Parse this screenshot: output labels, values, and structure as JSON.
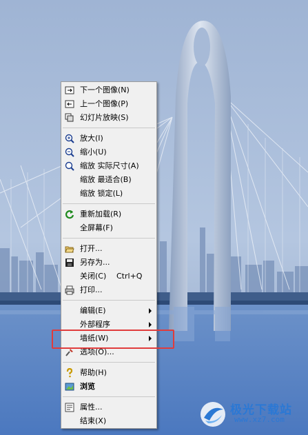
{
  "menu": {
    "items": [
      {
        "label": "下一个图像(N)",
        "icon": "next-image-icon"
      },
      {
        "label": "上一个图像(P)",
        "icon": "prev-image-icon"
      },
      {
        "label": "幻灯片放映(S)",
        "icon": "slideshow-icon"
      },
      {
        "label": "放大(I)",
        "icon": "zoom-in-icon"
      },
      {
        "label": "缩小(U)",
        "icon": "zoom-out-icon"
      },
      {
        "label": "缩放 实际尺寸(A)",
        "icon": "zoom-actual-icon"
      },
      {
        "label": "缩放 最适合(B)"
      },
      {
        "label": "缩放 锁定(L)"
      },
      {
        "label": "重新加载(R)",
        "icon": "reload-icon"
      },
      {
        "label": "全屏幕(F)"
      },
      {
        "label": "打开...",
        "icon": "open-folder-icon"
      },
      {
        "label": "另存为...",
        "icon": "save-icon"
      },
      {
        "label": "关闭(C)",
        "shortcut": "Ctrl+Q"
      },
      {
        "label": "打印...",
        "icon": "print-icon"
      },
      {
        "label": "编辑(E)",
        "submenu": true
      },
      {
        "label": "外部程序",
        "submenu": true
      },
      {
        "label": "墙纸(W)",
        "submenu": true
      },
      {
        "label": "选项(O)...",
        "icon": "options-icon"
      },
      {
        "label": "帮助(H)",
        "icon": "help-icon"
      },
      {
        "label": "浏览",
        "icon": "browse-icon"
      },
      {
        "label": "属性...",
        "icon": "properties-icon"
      },
      {
        "label": "结束(X)"
      }
    ]
  },
  "watermark": {
    "brand": "极光下载站",
    "url": "www.xz7.com"
  },
  "colors": {
    "highlight_border": "#e03b3b",
    "menu_bg": "#f0f0f0",
    "watermark": "#2b78d4"
  }
}
